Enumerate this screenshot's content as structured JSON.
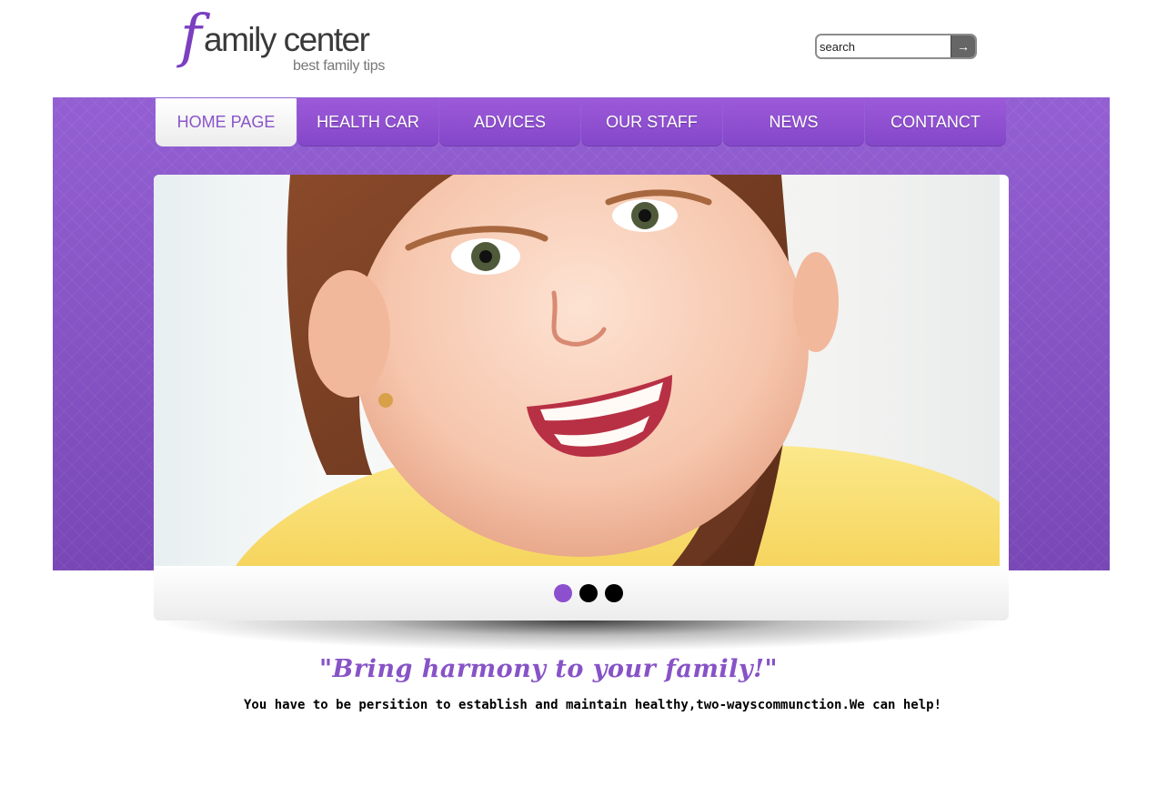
{
  "header": {
    "logo_letter": "f",
    "logo_text": "amily center",
    "logo_tagline": "best family tips",
    "search": {
      "value": "search",
      "button_icon": "arrow-right-icon",
      "button_glyph": "→"
    }
  },
  "nav": {
    "items": [
      {
        "label": "HOME PAGE",
        "active": true
      },
      {
        "label": "HEALTH CAR",
        "active": false
      },
      {
        "label": "ADVICES",
        "active": false
      },
      {
        "label": "OUR STAFF",
        "active": false
      },
      {
        "label": "NEWS",
        "active": false
      },
      {
        "label": "CONTANCT",
        "active": false
      }
    ]
  },
  "slider": {
    "image": "smiling-girl-photo",
    "dots": [
      {
        "active": true
      },
      {
        "active": false
      },
      {
        "active": false
      }
    ]
  },
  "content": {
    "slogan": "\"Bring harmony to your family!\"",
    "tagline": "You have to be persition to establish and maintain healthy,two-wayscommunction.We can help!"
  },
  "colors": {
    "accent": "#8a52cf",
    "nav_active_text": "#8a55c8",
    "slogan": "#8753c7",
    "dot_active": "#8c4fce",
    "dot_inactive": "#000000"
  }
}
